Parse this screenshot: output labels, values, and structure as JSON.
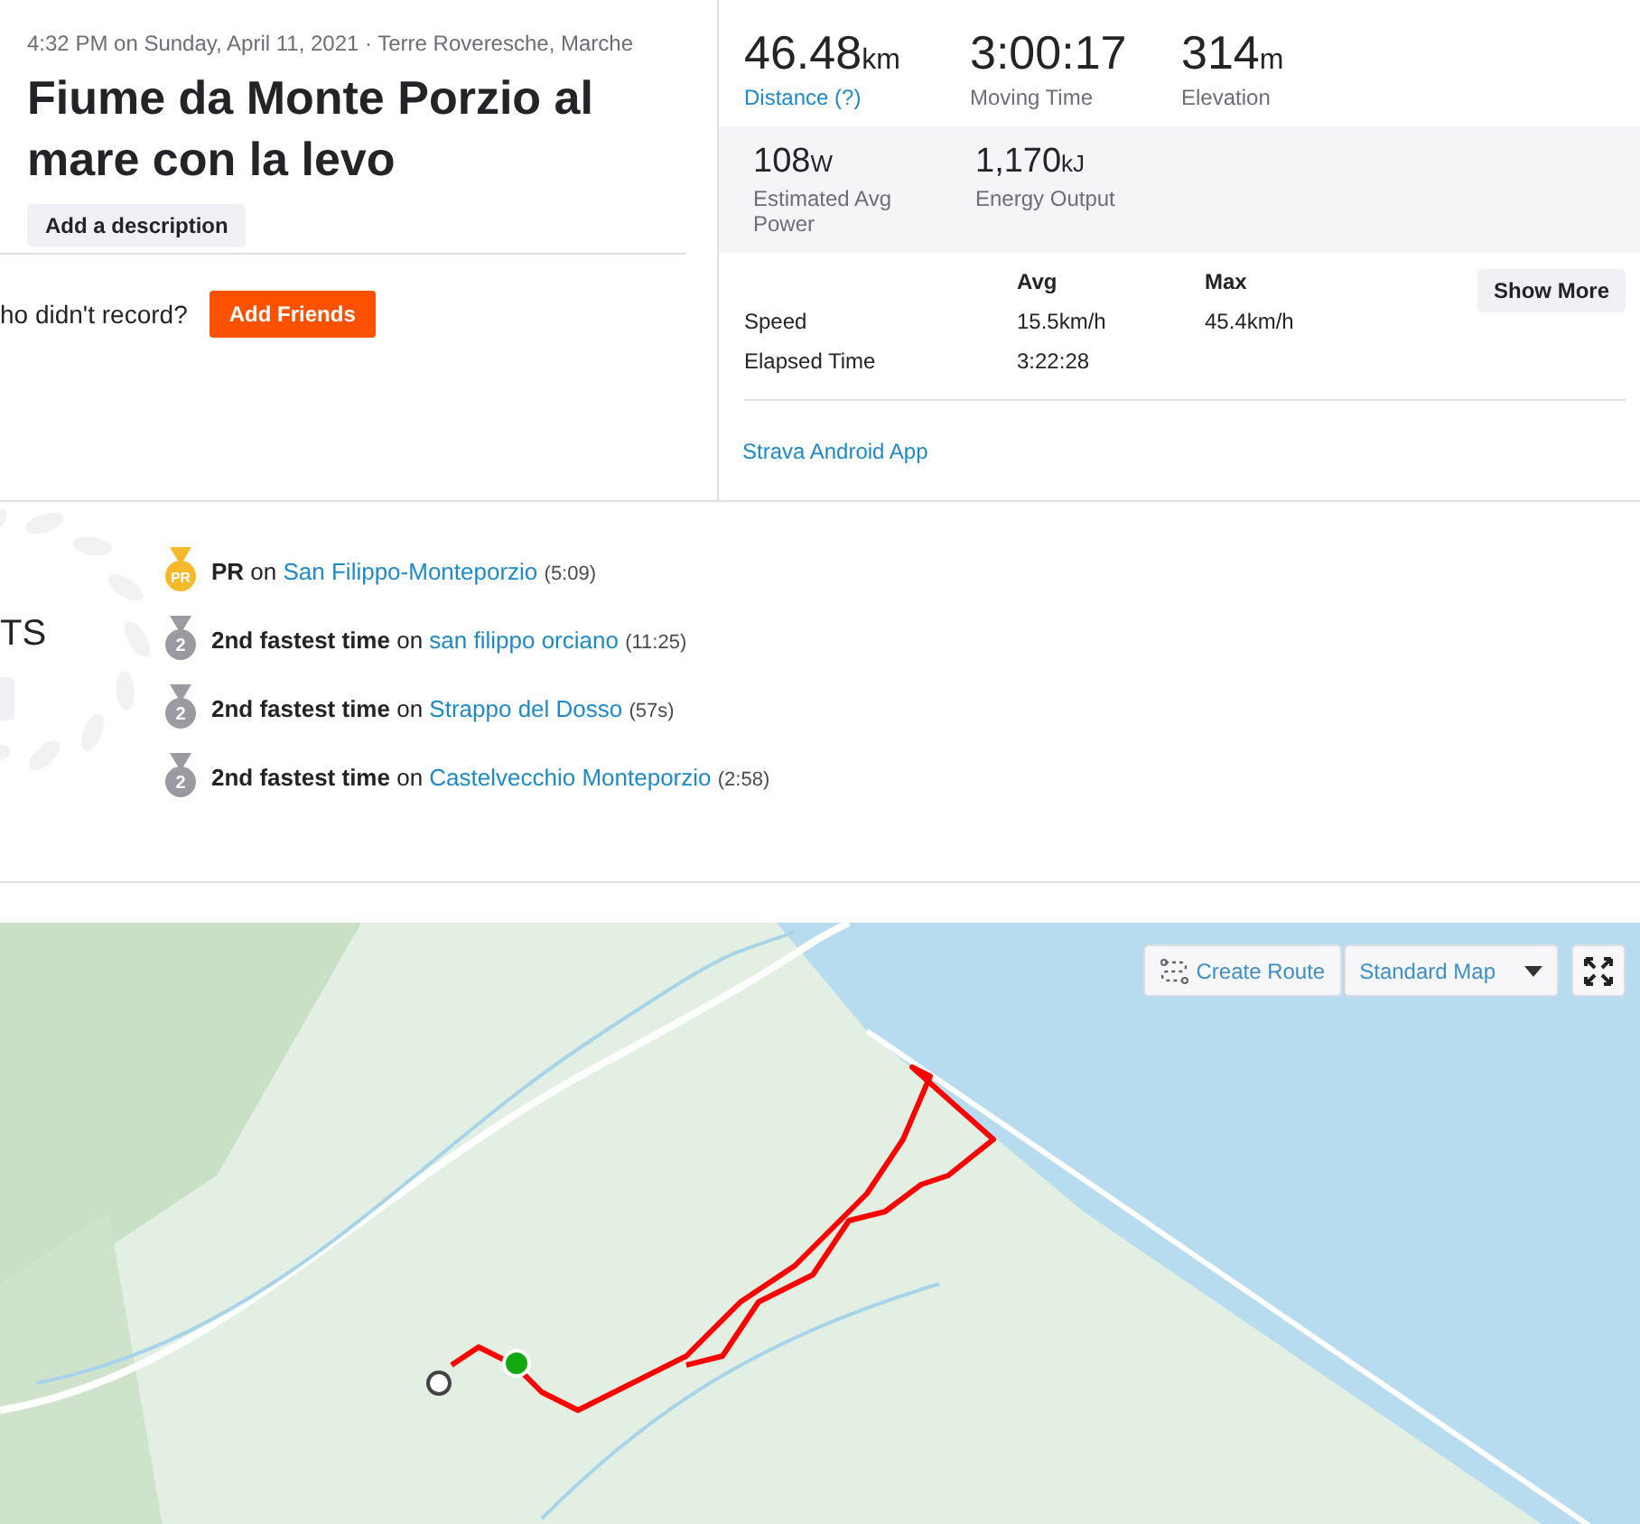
{
  "activity": {
    "meta": "4:32 PM on Sunday, April 11, 2021 · Terre Roveresche, Marche",
    "title": "Fiume da Monte Porzio al mare con la levo",
    "description_button": "Add a description"
  },
  "friends": {
    "prompt": "ho didn't record?",
    "button": "Add Friends"
  },
  "primary_stats": [
    {
      "value": "46.48",
      "unit": "km",
      "label": "Distance (?)",
      "kind": "link"
    },
    {
      "value": "3:00:17",
      "label": "Moving Time",
      "kind": "plain"
    },
    {
      "value": "314",
      "unit": "m",
      "label": "Elevation",
      "kind": "plain"
    }
  ],
  "secondary_stats": [
    {
      "value": "108",
      "unit": "W",
      "label": "Estimated Avg Power"
    },
    {
      "value": "1,170",
      "unit": "kJ",
      "label": "Energy Output"
    }
  ],
  "details": {
    "columns": [
      "Avg",
      "Max"
    ],
    "rows": [
      {
        "label": "Speed",
        "avg": "15.5km/h",
        "max": "45.4km/h"
      },
      {
        "label": "Elapsed Time",
        "avg": "3:22:28"
      }
    ],
    "show_more": "Show More"
  },
  "device": "Strava Android App",
  "achievements": {
    "heading": "TS",
    "items": [
      {
        "kind": "pr",
        "medal": "PR",
        "text": "**PR** on",
        "segment": "San Filippo-Monteporzio",
        "time": "(5:09)"
      },
      {
        "kind": "silver",
        "medal": "2",
        "text": "**2nd fastest time** on",
        "segment": "san filippo orciano",
        "time": "(11:25)"
      },
      {
        "kind": "silver",
        "medal": "2",
        "text": "**2nd fastest time** on",
        "segment": "Strappo del Dosso",
        "time": "(57s)"
      },
      {
        "kind": "silver",
        "medal": "2",
        "text": "**2nd fastest time** on",
        "segment": "Castelvecchio Monteporzio",
        "time": "(2:58)"
      }
    ]
  },
  "map": {
    "create_route": "Create Route",
    "map_type": "Standard Map"
  }
}
